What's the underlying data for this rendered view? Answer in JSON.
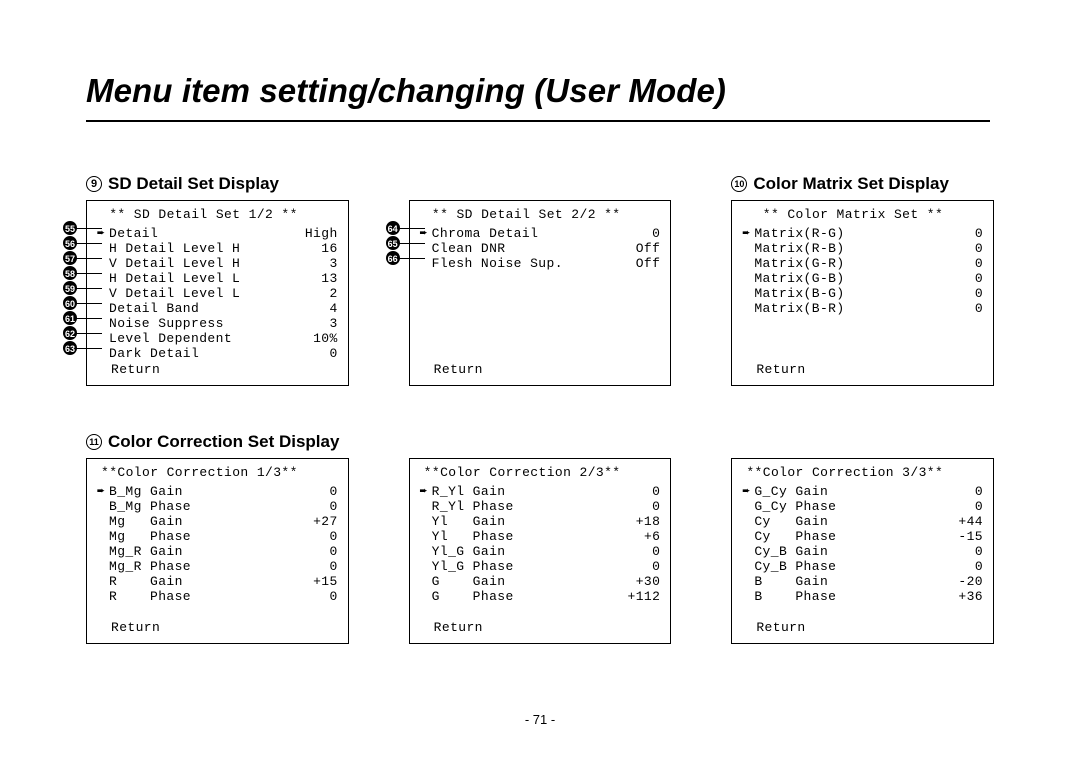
{
  "title": "Menu item setting/changing (User Mode)",
  "page_number": "- 71 -",
  "headings": {
    "h9_num": "9",
    "h9_label": "SD Detail Set Display",
    "h10_num": "10",
    "h10_label": "Color Matrix Set Display",
    "h11_num": "11",
    "h11_label": "Color Correction Set Display"
  },
  "return_label": "Return",
  "arrow_glyph": "➨",
  "panels": {
    "sd1": {
      "title": " ** SD Detail Set 1/2 **",
      "items": [
        {
          "arrow": true,
          "label": "Detail",
          "value": "High"
        },
        {
          "arrow": false,
          "label": "H Detail Level H",
          "value": "16"
        },
        {
          "arrow": false,
          "label": "V Detail Level H",
          "value": "3"
        },
        {
          "arrow": false,
          "label": "H Detail Level L",
          "value": "13"
        },
        {
          "arrow": false,
          "label": "V Detail Level L",
          "value": "2"
        },
        {
          "arrow": false,
          "label": "Detail Band",
          "value": "4"
        },
        {
          "arrow": false,
          "label": "Noise Suppress",
          "value": "3"
        },
        {
          "arrow": false,
          "label": "Level Dependent",
          "value": "10%"
        },
        {
          "arrow": false,
          "label": "Dark Detail",
          "value": "0"
        }
      ],
      "callouts": [
        "55",
        "56",
        "57",
        "58",
        "59",
        "60",
        "61",
        "62",
        "63"
      ]
    },
    "sd2": {
      "title": " ** SD Detail Set 2/2 **",
      "items": [
        {
          "arrow": true,
          "label": "Chroma Detail",
          "value": "0"
        },
        {
          "arrow": false,
          "label": "Clean DNR",
          "value": "Off"
        },
        {
          "arrow": false,
          "label": "Flesh Noise Sup.",
          "value": "Off"
        }
      ],
      "callouts": [
        "64",
        "65",
        "66"
      ]
    },
    "cmatrix": {
      "title": "  ** Color Matrix Set **",
      "items": [
        {
          "arrow": true,
          "label": "Matrix(R-G)",
          "value": "0"
        },
        {
          "arrow": false,
          "label": "Matrix(R-B)",
          "value": "0"
        },
        {
          "arrow": false,
          "label": "Matrix(G-R)",
          "value": "0"
        },
        {
          "arrow": false,
          "label": "Matrix(G-B)",
          "value": "0"
        },
        {
          "arrow": false,
          "label": "Matrix(B-G)",
          "value": "0"
        },
        {
          "arrow": false,
          "label": "Matrix(B-R)",
          "value": "0"
        }
      ]
    },
    "cc1": {
      "title": "**Color Correction 1/3**",
      "items": [
        {
          "arrow": true,
          "label": "B_Mg Gain",
          "value": "0"
        },
        {
          "arrow": false,
          "label": "B_Mg Phase",
          "value": "0"
        },
        {
          "arrow": false,
          "label": "Mg   Gain",
          "value": "+27"
        },
        {
          "arrow": false,
          "label": "Mg   Phase",
          "value": "0"
        },
        {
          "arrow": false,
          "label": "Mg_R Gain",
          "value": "0"
        },
        {
          "arrow": false,
          "label": "Mg_R Phase",
          "value": "0"
        },
        {
          "arrow": false,
          "label": "R    Gain",
          "value": "+15"
        },
        {
          "arrow": false,
          "label": "R    Phase",
          "value": "0"
        }
      ]
    },
    "cc2": {
      "title": "**Color Correction 2/3**",
      "items": [
        {
          "arrow": true,
          "label": "R_Yl Gain",
          "value": "0"
        },
        {
          "arrow": false,
          "label": "R_Yl Phase",
          "value": "0"
        },
        {
          "arrow": false,
          "label": "Yl   Gain",
          "value": "+18"
        },
        {
          "arrow": false,
          "label": "Yl   Phase",
          "value": "+6"
        },
        {
          "arrow": false,
          "label": "Yl_G Gain",
          "value": "0"
        },
        {
          "arrow": false,
          "label": "Yl_G Phase",
          "value": "0"
        },
        {
          "arrow": false,
          "label": "G    Gain",
          "value": "+30"
        },
        {
          "arrow": false,
          "label": "G    Phase",
          "value": "+112"
        }
      ]
    },
    "cc3": {
      "title": "**Color Correction 3/3**",
      "items": [
        {
          "arrow": true,
          "label": "G_Cy Gain",
          "value": "0"
        },
        {
          "arrow": false,
          "label": "G_Cy Phase",
          "value": "0"
        },
        {
          "arrow": false,
          "label": "Cy   Gain",
          "value": "+44"
        },
        {
          "arrow": false,
          "label": "Cy   Phase",
          "value": "-15"
        },
        {
          "arrow": false,
          "label": "Cy_B Gain",
          "value": "0"
        },
        {
          "arrow": false,
          "label": "Cy_B Phase",
          "value": "0"
        },
        {
          "arrow": false,
          "label": "B    Gain",
          "value": "-20"
        },
        {
          "arrow": false,
          "label": "B    Phase",
          "value": "+36"
        }
      ]
    }
  }
}
